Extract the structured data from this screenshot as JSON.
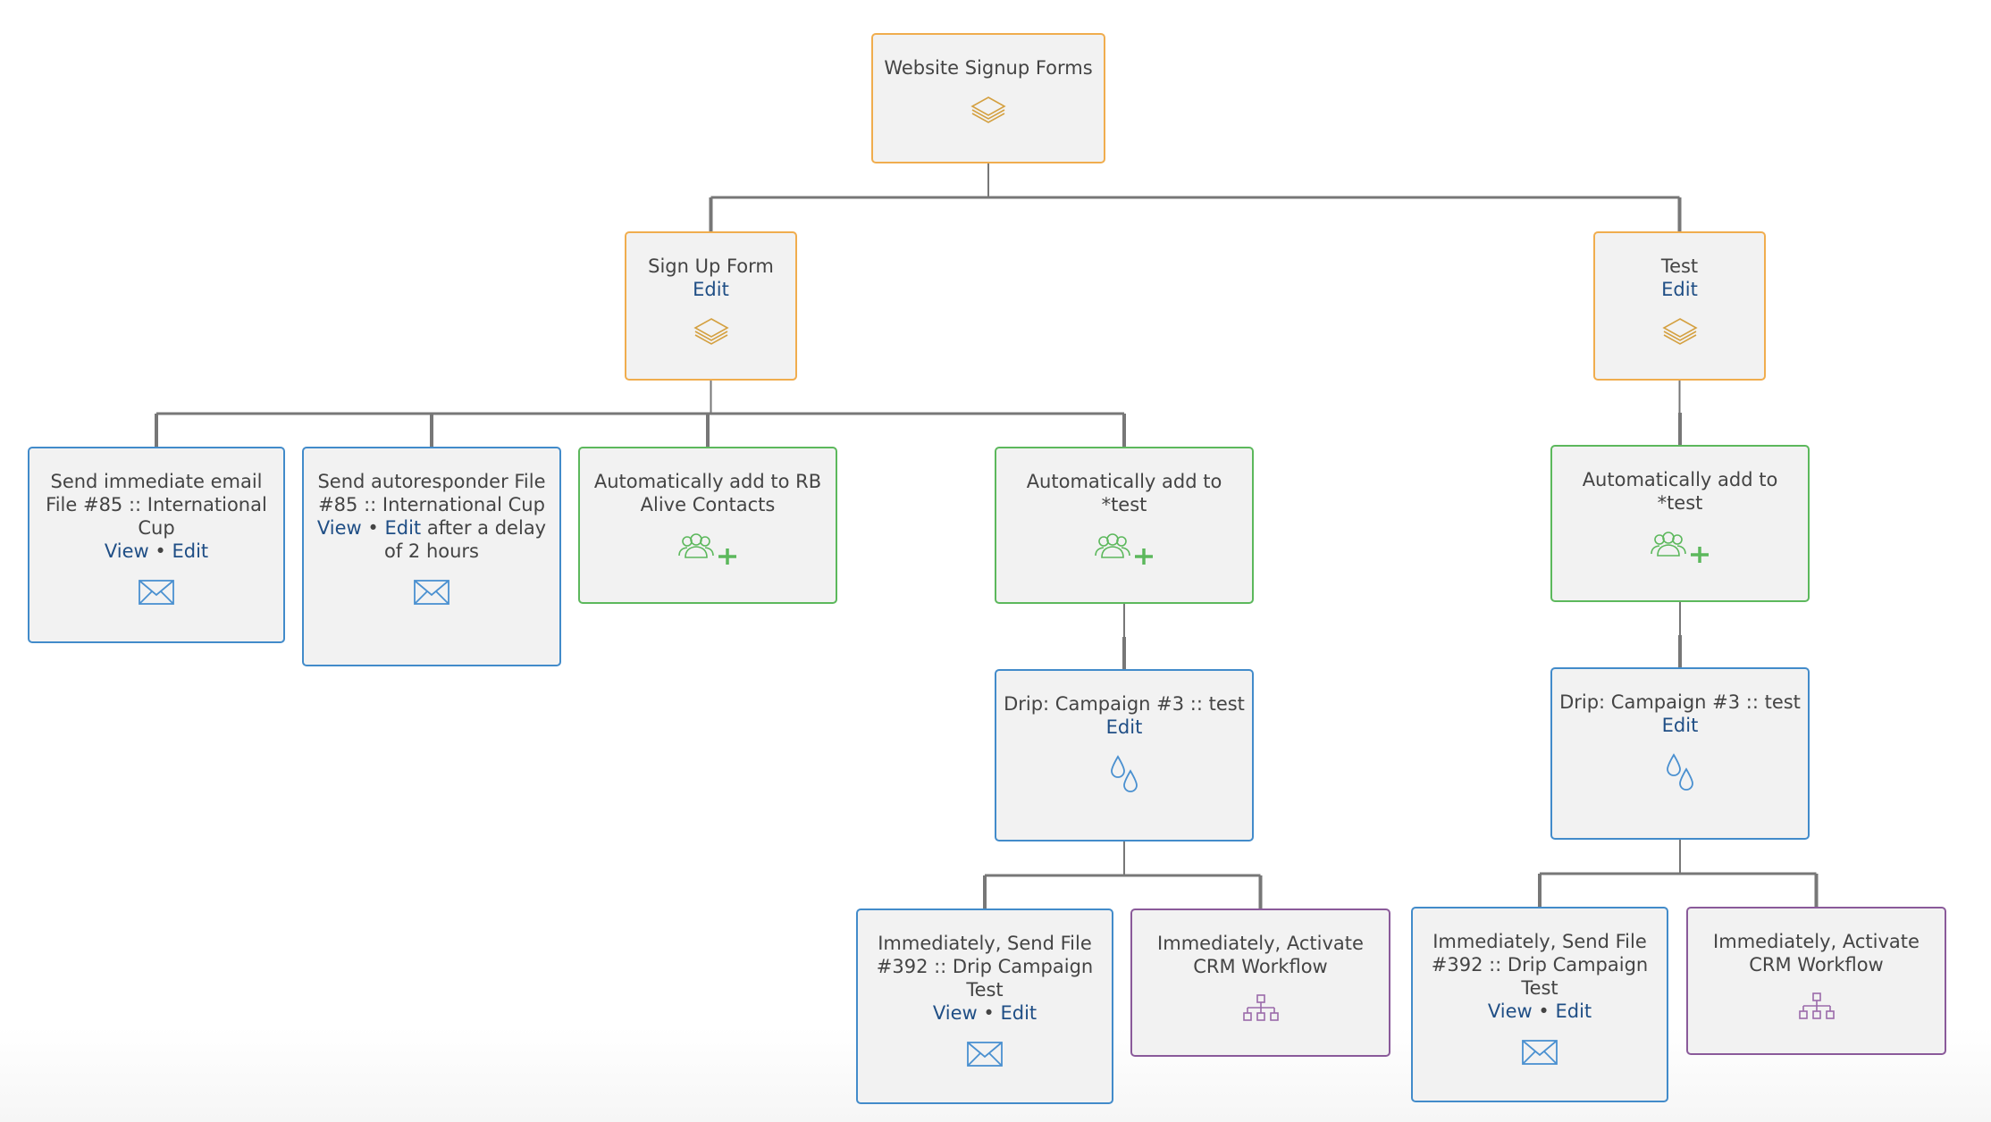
{
  "colors": {
    "form": "#f0ad4e",
    "email": "#428bca",
    "contacts": "#5cb85c",
    "workflow": "#8a5a9a",
    "connector": "#777777",
    "link": "#1f4e85",
    "node_bg": "#f2f2f2",
    "text": "#444444"
  },
  "nodes": {
    "root": {
      "title": "Website Signup Forms",
      "icon": "layers-icon"
    },
    "signup_form": {
      "title": "Sign Up Form",
      "edit": "Edit",
      "icon": "layers-icon"
    },
    "test_form": {
      "title": "Test",
      "edit": "Edit",
      "icon": "layers-icon"
    },
    "send_immediate": {
      "title": "Send immediate email File #85 :: International Cup",
      "view": "View",
      "sep": "•",
      "edit": "Edit",
      "icon": "envelope-icon"
    },
    "send_autoresponder": {
      "title": "Send autoresponder File #85 :: International Cup",
      "view": "View",
      "sep": "•",
      "edit": "Edit",
      "suffix": " after a delay of 2 hours",
      "icon": "envelope-icon"
    },
    "add_rb_alive": {
      "title": "Automatically add to RB Alive Contacts",
      "icon": "add-group-icon"
    },
    "add_test_left": {
      "title": "Automatically add to *test",
      "icon": "add-group-icon"
    },
    "add_test_right": {
      "title": "Automatically add to *test",
      "icon": "add-group-icon"
    },
    "drip_left": {
      "title": "Drip: Campaign #3 :: test",
      "edit": "Edit",
      "icon": "drops-icon"
    },
    "drip_right": {
      "title": "Drip: Campaign #3 :: test",
      "edit": "Edit",
      "icon": "drops-icon"
    },
    "send_392_left": {
      "title": "Immediately, Send File #392 :: Drip Campaign Test",
      "view": "View",
      "sep": "•",
      "edit": "Edit",
      "icon": "envelope-icon"
    },
    "crm_left": {
      "title": "Immediately, Activate CRM Workflow",
      "icon": "sitemap-icon"
    },
    "send_392_right": {
      "title": "Immediately, Send File #392 :: Drip Campaign Test",
      "view": "View",
      "sep": "•",
      "edit": "Edit",
      "icon": "envelope-icon"
    },
    "crm_right": {
      "title": "Immediately, Activate CRM Workflow",
      "icon": "sitemap-icon"
    }
  },
  "edges": [
    [
      "root",
      "signup_form"
    ],
    [
      "root",
      "test_form"
    ],
    [
      "signup_form",
      "send_immediate"
    ],
    [
      "signup_form",
      "send_autoresponder"
    ],
    [
      "signup_form",
      "add_rb_alive"
    ],
    [
      "signup_form",
      "add_test_left"
    ],
    [
      "test_form",
      "add_test_right"
    ],
    [
      "add_test_left",
      "drip_left"
    ],
    [
      "add_test_right",
      "drip_right"
    ],
    [
      "drip_left",
      "send_392_left"
    ],
    [
      "drip_left",
      "crm_left"
    ],
    [
      "drip_right",
      "send_392_right"
    ],
    [
      "drip_right",
      "crm_right"
    ]
  ]
}
